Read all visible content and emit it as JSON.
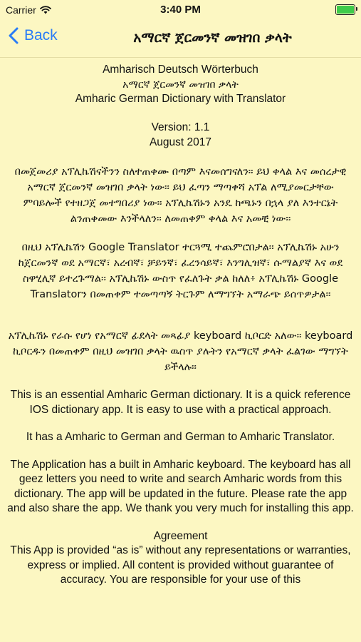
{
  "status_bar": {
    "carrier": "Carrier",
    "time": "3:40 PM",
    "battery_level": 1.0
  },
  "nav": {
    "back_label": "Back",
    "title": "አማርኛ ጀርመንኛ መዝገበ ቃላት"
  },
  "content": {
    "title_de": "Amharisch Deutsch Wörterbuch",
    "title_am": "አማርኛ ጀርመንኛ መዝገበ ቃላት",
    "title_en": "Amharic German Dictionary with Translator",
    "version": "Version:  1.1",
    "date": "August 2017",
    "amharic_para1": "በመጀመሪያ አፕሊኬሽናችንን ስለተጠቀሙ በጣም እናመሰግናለን። ይህ ቀላል እና መሰረታዊ አማርኛ ጀርመንኛ መዝገበ ቃላት ነው፡፡ ይህ ፈጣን ማጣቀሻ አፕል ለሚያመርታቸው ምባይሎች የተዘጋጀ መተግበሪያ ነው፡፡  አፕሊኬሽኑን አንዴ ከጫኑን በኋላ ያለ እንተርኔት ልንጠቀመው እንችላለን፡፡ ለመጠቀም ቀላል እና አመቺ ነው፡፡",
    "amharic_para2": "በዚህ አፕሊኬሽን Google Translator ተርጓሚ ተጨምሮበታል፡፡ አፕሊኬሽኑ አሁን ከጀርመንኛ ወደ አማርኛ፣ አረብኛ፣ ቻይንኛ፣ ፈረንሳይኛ፣ እንግሊዝኛ፣ ሱማልያኛ እና ወደ ስዋሂሊኛ ይተረጉማል፡፡ አፕሊኬሽኑ ውስጥ የፈለጉት ቃል ከለለ፥ አፕሊኬሽኑ Google Translatorን በመጠቀም ተመጣጣኝ ትርጉም ለማግኘት አማራጭ ይሰጥዎታል፡፡",
    "amharic_para3": "አፕሊኬሽኑ የራሱ የሆነ የአማርኛ ፊደላት መጻፊያ keyboard ኪቦርድ አለው፡፡ keyboard ኪቦርዱን በመጠቀም በዚህ መዝገበ ቃላት ዉስጥ ያሉትን የአማርኛ ቃላት ፈልገው ማግኘት ይችላሉ፡፡",
    "english_para1": "This is an essential Amharic German dictionary. It is a quick reference IOS dictionary app. It is easy to use with a practical approach.",
    "english_para2": "It has a Amharic to German and German to Amharic Translator.",
    "english_para3": "The Application has a built in Amharic keyboard. The keyboard has all geez letters you need to write and search Amharic words from this dictionary. The app will be updated in the future. Please rate the app and also share the app.   We thank you very much for installing this app.",
    "agreement_heading": "Agreement",
    "agreement_text": "This App is provided “as is” without any representations or warranties, express or implied.  All content is provided without guarantee of accuracy.  You are responsible for your use of this"
  }
}
